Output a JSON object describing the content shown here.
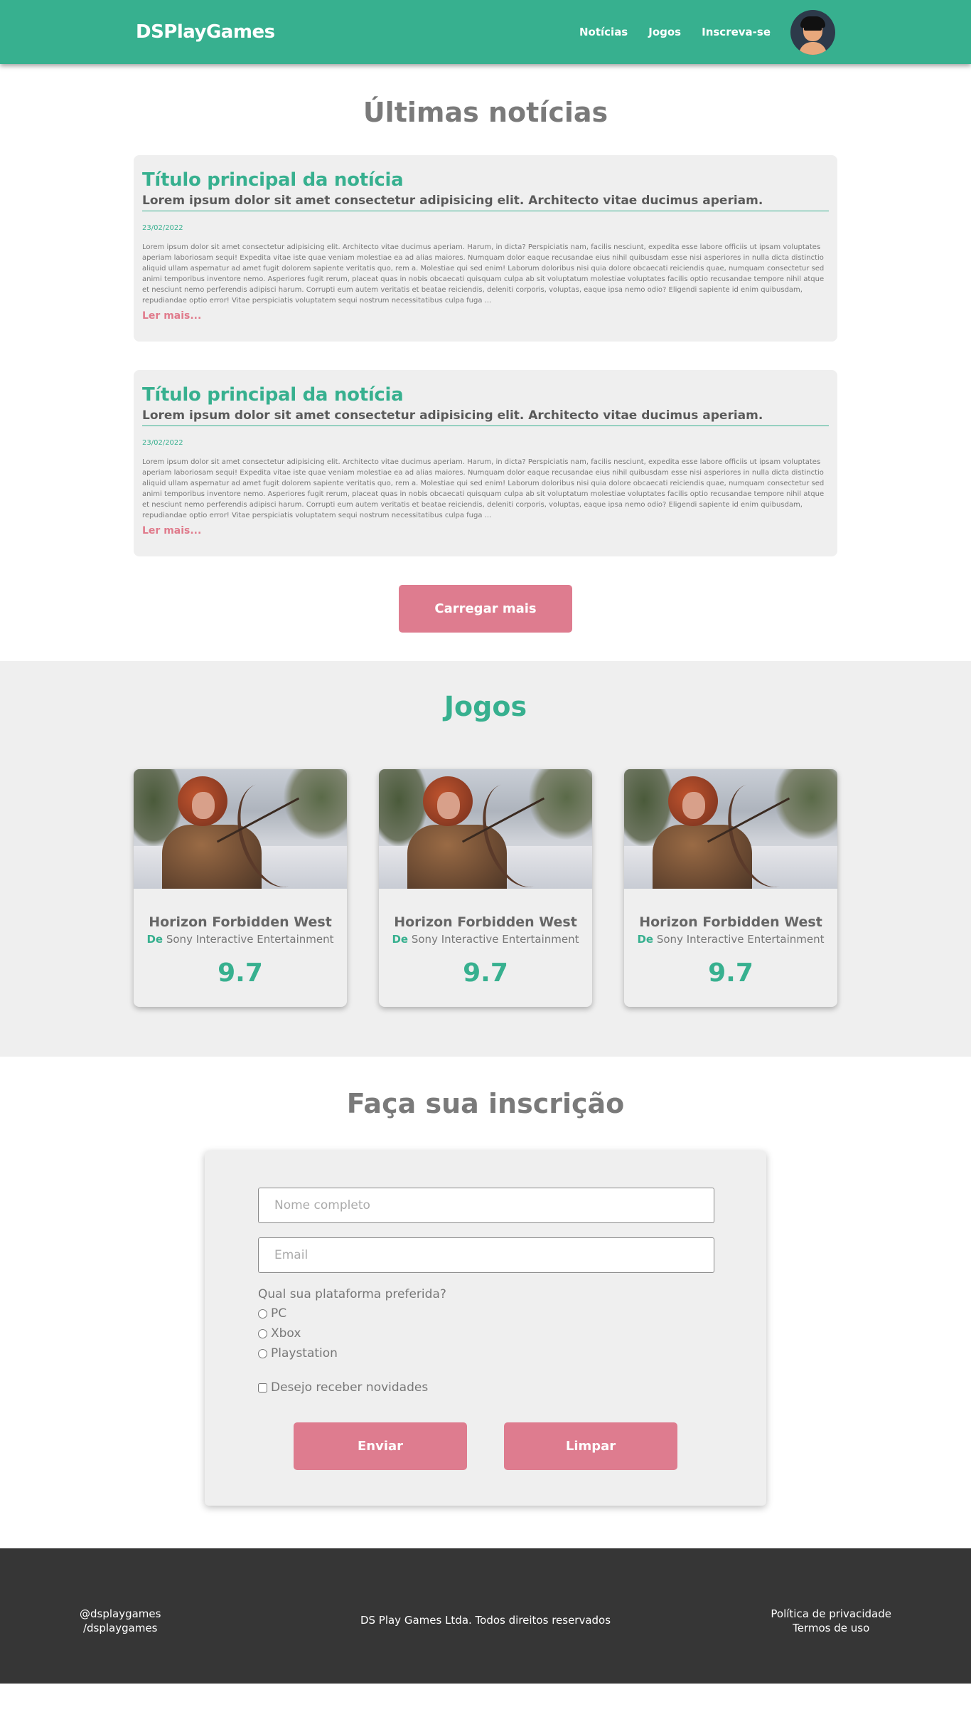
{
  "header": {
    "brand": "DSPlayGames",
    "nav": [
      "Notícias",
      "Jogos",
      "Inscreva-se"
    ]
  },
  "news": {
    "section_title": "Últimas notícias",
    "items": [
      {
        "title": "Título principal da notícia",
        "subtitle": "Lorem ipsum dolor sit amet consectetur adipisicing elit. Architecto vitae ducimus aperiam.",
        "date": "23/02/2022",
        "body": "Lorem ipsum dolor sit amet consectetur adipisicing elit. Architecto vitae ducimus aperiam. Harum, in dicta? Perspiciatis nam, facilis nesciunt, expedita esse labore officiis ut ipsam voluptates aperiam laboriosam sequi! Expedita vitae iste quae veniam molestiae ea ad alias maiores. Numquam dolor eaque recusandae eius nihil quibusdam esse nisi asperiores in nulla dicta distinctio aliquid ullam aspernatur ad amet fugit dolorem sapiente veritatis quo, rem a. Molestiae qui sed enim! Laborum doloribus nisi quia dolore obcaecati reiciendis quae, numquam consectetur sed animi temporibus inventore nemo. Asperiores fugit rerum, placeat quas in nobis obcaecati quisquam culpa ab sit voluptatum molestiae voluptates facilis optio recusandae tempore nihil atque et nesciunt nemo perferendis adipisci harum. Corrupti eum autem veritatis et beatae reiciendis, deleniti corporis, voluptas, eaque ipsa nemo odio? Eligendi sapiente id enim quibusdam, repudiandae optio error! Vitae perspiciatis voluptatem sequi nostrum necessitatibus culpa fuga ...",
        "read_more": "Ler mais..."
      },
      {
        "title": "Título principal da notícia",
        "subtitle": "Lorem ipsum dolor sit amet consectetur adipisicing elit. Architecto vitae ducimus aperiam.",
        "date": "23/02/2022",
        "body": "Lorem ipsum dolor sit amet consectetur adipisicing elit. Architecto vitae ducimus aperiam. Harum, in dicta? Perspiciatis nam, facilis nesciunt, expedita esse labore officiis ut ipsam voluptates aperiam laboriosam sequi! Expedita vitae iste quae veniam molestiae ea ad alias maiores. Numquam dolor eaque recusandae eius nihil quibusdam esse nisi asperiores in nulla dicta distinctio aliquid ullam aspernatur ad amet fugit dolorem sapiente veritatis quo, rem a. Molestiae qui sed enim! Laborum doloribus nisi quia dolore obcaecati reiciendis quae, numquam consectetur sed animi temporibus inventore nemo. Asperiores fugit rerum, placeat quas in nobis obcaecati quisquam culpa ab sit voluptatum molestiae voluptates facilis optio recusandae tempore nihil atque et nesciunt nemo perferendis adipisci harum. Corrupti eum autem veritatis et beatae reiciendis, deleniti corporis, voluptas, eaque ipsa nemo odio? Eligendi sapiente id enim quibusdam, repudiandae optio error! Vitae perspiciatis voluptatem sequi nostrum necessitatibus culpa fuga ...",
        "read_more": "Ler mais..."
      }
    ],
    "load_more": "Carregar mais"
  },
  "games": {
    "section_title": "Jogos",
    "items": [
      {
        "name": "Horizon Forbidden West",
        "by": "De",
        "publisher": "Sony Interactive Entertainment",
        "score": "9.7"
      },
      {
        "name": "Horizon Forbidden West",
        "by": "De",
        "publisher": "Sony Interactive Entertainment",
        "score": "9.7"
      },
      {
        "name": "Horizon Forbidden West",
        "by": "De",
        "publisher": "Sony Interactive Entertainment",
        "score": "9.7"
      }
    ]
  },
  "signup": {
    "section_title": "Faça sua inscrição",
    "name_placeholder": "Nome completo",
    "email_placeholder": "Email",
    "platform_question": "Qual sua plataforma preferida?",
    "platforms": [
      "PC",
      "Xbox",
      "Playstation"
    ],
    "newsletter_label": "Desejo receber novidades",
    "submit": "Enviar",
    "clear": "Limpar"
  },
  "footer": {
    "social_handle": "@dsplaygames",
    "social_path": "/dsplaygames",
    "copyright": "DS Play Games Ltda. Todos direitos reservados",
    "privacy": "Política de privacidade",
    "terms": "Termos de uso"
  },
  "colors": {
    "accent": "#37b08f",
    "button": "#de7c8f",
    "footer": "#363636",
    "panel": "#efefef"
  }
}
